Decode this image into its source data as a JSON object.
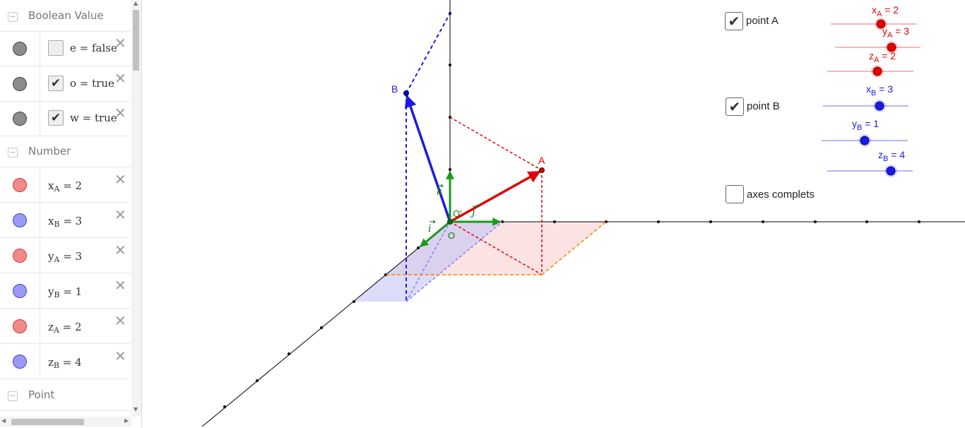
{
  "algebra": {
    "groups": {
      "boolean": "Boolean Value",
      "number": "Number",
      "point": "Point"
    },
    "booleans": [
      {
        "label": "e = false",
        "checked": false
      },
      {
        "label": "o = true",
        "checked": true
      },
      {
        "label": "w = true",
        "checked": true
      }
    ],
    "numbers": [
      {
        "base": "x",
        "sub": "A",
        "rest": " = 2",
        "color": "red"
      },
      {
        "base": "x",
        "sub": "B",
        "rest": " = 3",
        "color": "blue"
      },
      {
        "base": "y",
        "sub": "A",
        "rest": " = 3",
        "color": "red"
      },
      {
        "base": "y",
        "sub": "B",
        "rest": " = 1",
        "color": "blue"
      },
      {
        "base": "z",
        "sub": "A",
        "rest": " = 2",
        "color": "red"
      },
      {
        "base": "z",
        "sub": "B",
        "rest": " = 4",
        "color": "blue"
      }
    ],
    "icons": {
      "collapse": "−",
      "delete": "✕",
      "check": "✔"
    }
  },
  "widgets": {
    "pointA": {
      "label": "point A",
      "checked": true
    },
    "pointB": {
      "label": "point B",
      "checked": true
    },
    "axes": {
      "label": "axes complets",
      "checked": false
    }
  },
  "sliders": {
    "xA": {
      "base": "x",
      "sub": "A",
      "rest": " = 2",
      "value": 2
    },
    "yA": {
      "base": "y",
      "sub": "A",
      "rest": " = 3",
      "value": 3
    },
    "zA": {
      "base": "z",
      "sub": "A",
      "rest": " = 2",
      "value": 2
    },
    "xB": {
      "base": "x",
      "sub": "B",
      "rest": " = 3",
      "value": 3
    },
    "yB": {
      "base": "y",
      "sub": "B",
      "rest": " = 1",
      "value": 1
    },
    "zB": {
      "base": "z",
      "sub": "B",
      "rest": " = 4",
      "value": 4
    }
  },
  "labels": {
    "A": "A",
    "B": "B",
    "O": "O",
    "O2": "O'",
    "i": "i",
    "j": "j",
    "k": "k"
  },
  "colors": {
    "red": "#e00000",
    "blue": "#1a1ae6",
    "green": "#1a9a1a",
    "orange": "#ff8000"
  }
}
